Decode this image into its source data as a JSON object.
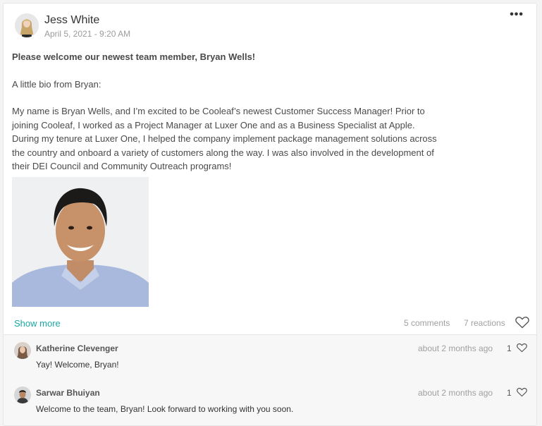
{
  "post": {
    "author": "Jess White",
    "date": "April 5, 2021 - 9:20 AM",
    "menu_label": "•••",
    "headline": "Please welcome our newest team member, Bryan Wells!",
    "intro": "A little bio from Bryan:",
    "bio": "My name is Bryan Wells, and I’m excited to be Cooleaf’s newest Customer Success Manager! Prior to joining Cooleaf, I worked as a Project Manager at Luxer One and as a Business Specialist at Apple. During my tenure at Luxer One, I helped the company implement package management solutions across the country and onboard a variety of customers along the way. I was also involved in the development of their DEI Council and Community Outreach programs!",
    "show_more": "Show more",
    "comments_count": "5 comments",
    "reactions_count": "7 reactions",
    "icons": {
      "menu": "more-horizontal-icon",
      "like": "heart-icon"
    }
  },
  "comments": [
    {
      "name": "Katherine Clevenger",
      "text": "Yay! Welcome, Bryan!",
      "time": "about 2 months ago",
      "likes": "1"
    },
    {
      "name": "Sarwar Bhuiyan",
      "text": "Welcome to the team, Bryan! Look forward to working with you soon.",
      "time": "about 2 months ago",
      "likes": "1"
    }
  ],
  "colors": {
    "accent": "#19a8a4",
    "muted": "#a0a0a0",
    "text": "#4a4a4a"
  }
}
